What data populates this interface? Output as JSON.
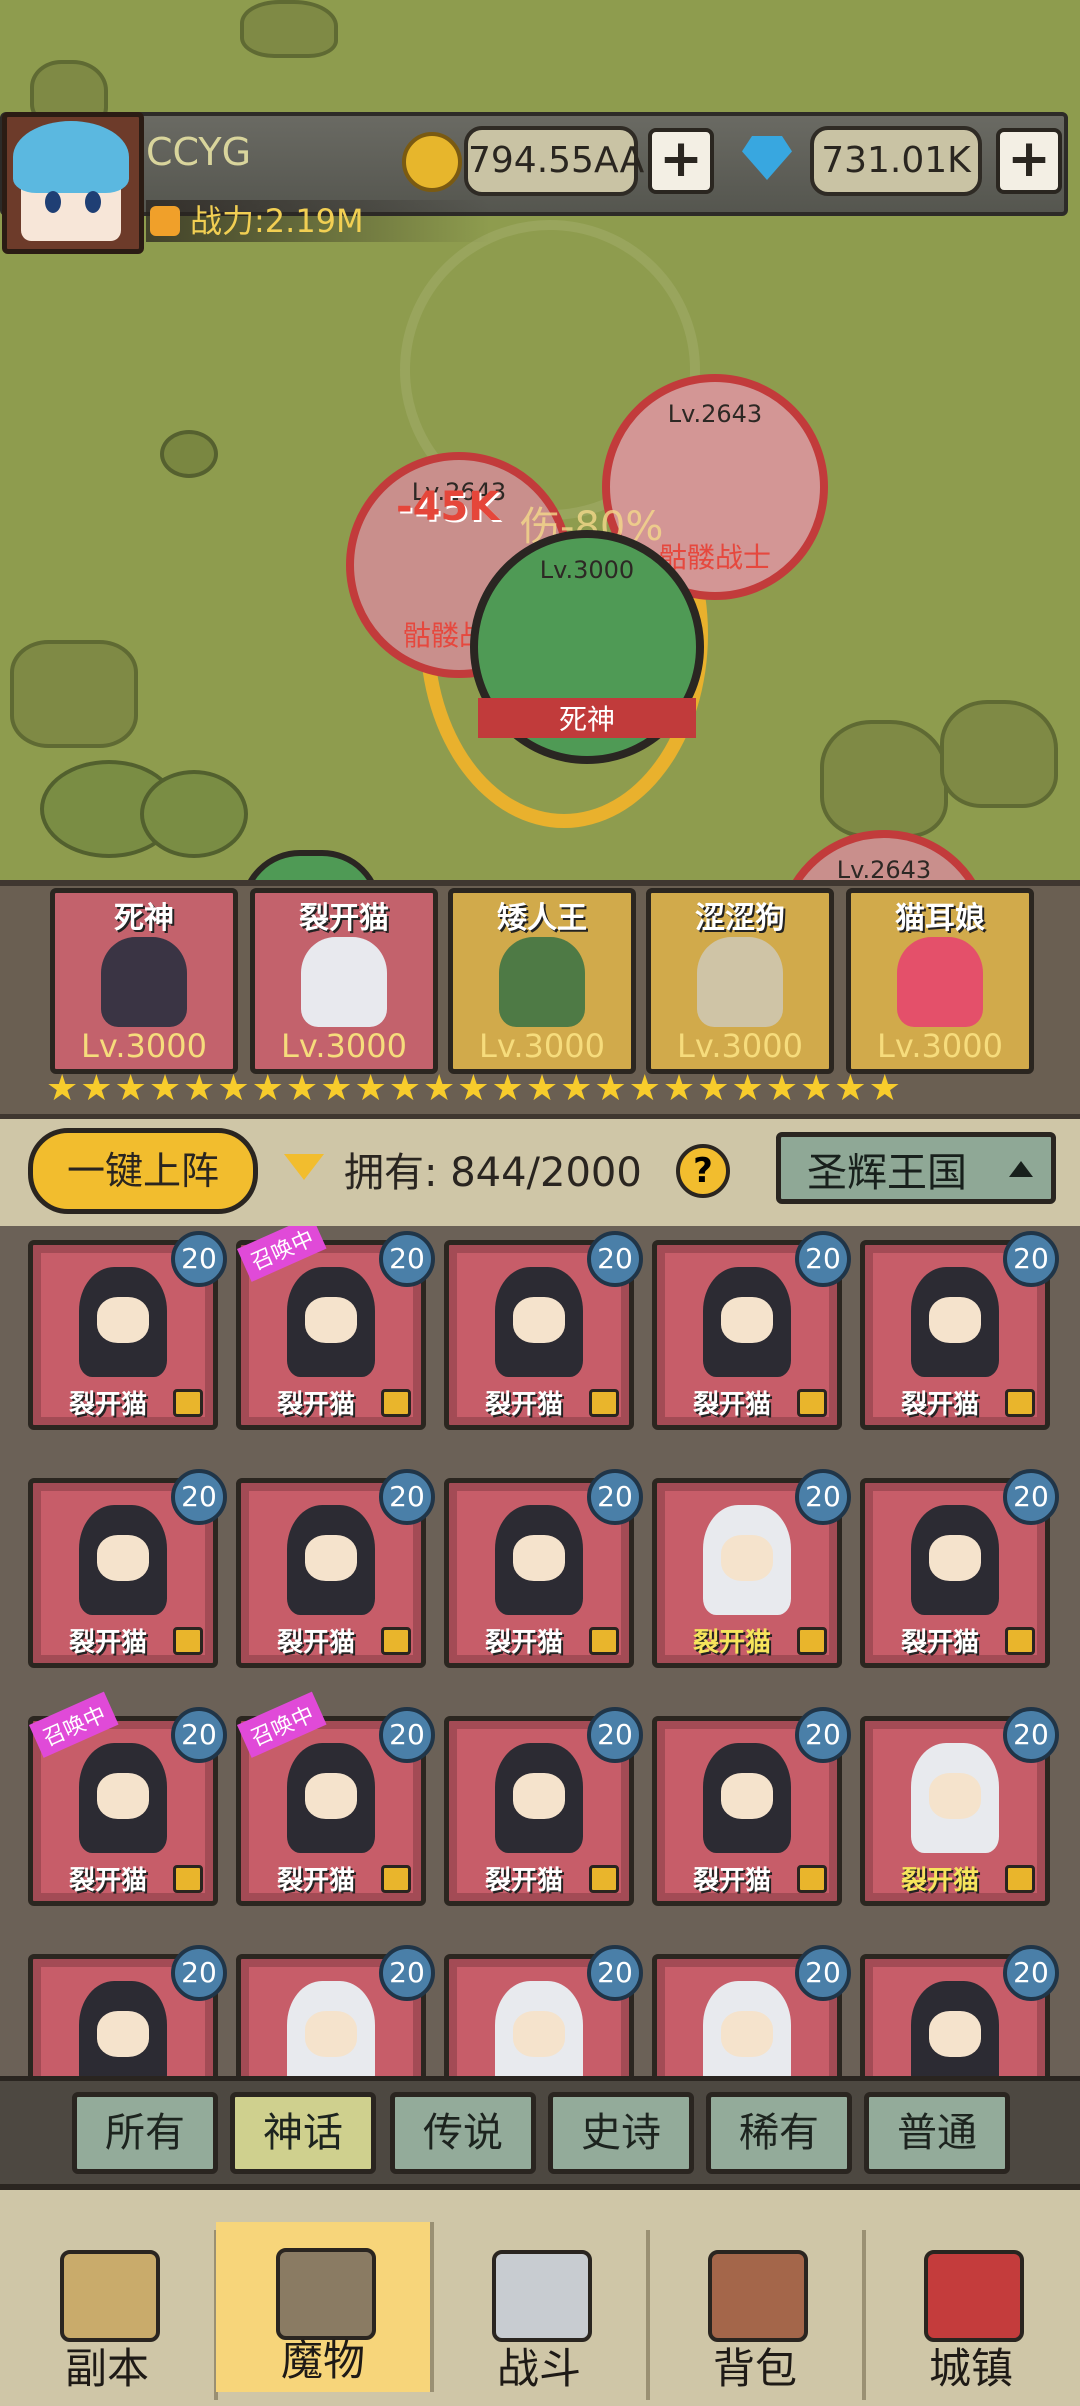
{
  "header": {
    "username": "CCYG",
    "power": "战力:2.19M",
    "gold": "794.55AA",
    "gems": "731.01K",
    "plus": "+"
  },
  "battle": {
    "damage_text": "-45K",
    "damage_reduction_text": "伤-80%",
    "units": [
      {
        "level": "Lv.2643",
        "name": "骷髅战士"
      },
      {
        "level": "Lv.2643",
        "name": "骷髅战士"
      },
      {
        "level": "Lv.3000",
        "name": "死神"
      },
      {
        "level": "Lv.2643",
        "name": ""
      }
    ]
  },
  "roster": [
    {
      "name": "死神",
      "level": "Lv.3000"
    },
    {
      "name": "裂开猫",
      "level": "Lv.3000"
    },
    {
      "name": "矮人王",
      "level": "Lv.3000"
    },
    {
      "name": "涩涩狗",
      "level": "Lv.3000"
    },
    {
      "name": "猫耳娘",
      "level": "Lv.3000"
    }
  ],
  "stars": "★★★★★★★★★★★★★★★★★★★★★★★★★",
  "controls": {
    "deploy_label": "一键上阵",
    "owned_label": "拥有: 844/2000",
    "help": "?",
    "kingdom": "圣辉王国"
  },
  "grid": [
    {
      "name": "裂开猫",
      "badge": "20",
      "summon": "",
      "white": false
    },
    {
      "name": "裂开猫",
      "badge": "20",
      "summon": "召唤中",
      "white": false
    },
    {
      "name": "裂开猫",
      "badge": "20",
      "summon": "",
      "white": false
    },
    {
      "name": "裂开猫",
      "badge": "20",
      "summon": "",
      "white": false
    },
    {
      "name": "裂开猫",
      "badge": "20",
      "summon": "",
      "white": false
    },
    {
      "name": "裂开猫",
      "badge": "20",
      "summon": "",
      "white": false
    },
    {
      "name": "裂开猫",
      "badge": "20",
      "summon": "",
      "white": false
    },
    {
      "name": "裂开猫",
      "badge": "20",
      "summon": "",
      "white": false
    },
    {
      "name": "裂开猫",
      "badge": "20",
      "summon": "",
      "white": true
    },
    {
      "name": "裂开猫",
      "badge": "20",
      "summon": "",
      "white": false
    },
    {
      "name": "裂开猫",
      "badge": "20",
      "summon": "召唤中",
      "white": false
    },
    {
      "name": "裂开猫",
      "badge": "20",
      "summon": "召唤中",
      "white": false
    },
    {
      "name": "裂开猫",
      "badge": "20",
      "summon": "",
      "white": false
    },
    {
      "name": "裂开猫",
      "badge": "20",
      "summon": "",
      "white": false
    },
    {
      "name": "裂开猫",
      "badge": "20",
      "summon": "",
      "white": true
    },
    {
      "name": "",
      "badge": "20",
      "summon": "",
      "white": false
    },
    {
      "name": "",
      "badge": "20",
      "summon": "",
      "white": true
    },
    {
      "name": "",
      "badge": "20",
      "summon": "",
      "white": true
    },
    {
      "name": "",
      "badge": "20",
      "summon": "",
      "white": true
    },
    {
      "name": "",
      "badge": "20",
      "summon": "",
      "white": false
    }
  ],
  "filters": [
    "所有",
    "神话",
    "传说",
    "史诗",
    "稀有",
    "普通"
  ],
  "nav": [
    "副本",
    "魔物",
    "战斗",
    "背包",
    "城镇"
  ],
  "colors": {
    "map": "#8e9c4e",
    "accent": "#f2bd2e",
    "tile": "#c75d69",
    "filter_active": "#cfd08e",
    "nav_active": "#f7d57a"
  }
}
